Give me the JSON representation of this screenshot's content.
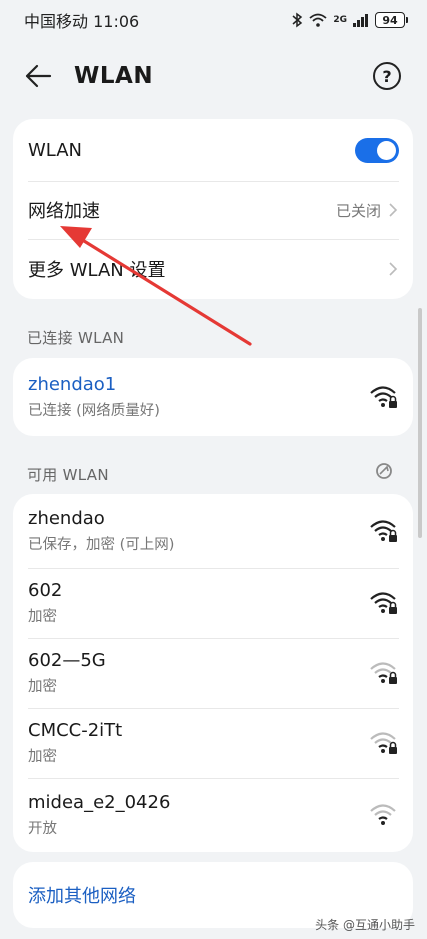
{
  "status_bar": {
    "carrier_time": "中国移动 11:06",
    "network": "2G",
    "battery": "94"
  },
  "header": {
    "title": "WLAN",
    "help": "?"
  },
  "settings": {
    "wlan_label": "WLAN",
    "wlan_enabled": true,
    "accel_label": "网络加速",
    "accel_value": "已关闭",
    "more_label": "更多 WLAN 设置"
  },
  "connected": {
    "section_title": "已连接 WLAN",
    "name": "zhendao1",
    "status": "已连接 (网络质量好)"
  },
  "available": {
    "section_title": "可用 WLAN",
    "networks": [
      {
        "name": "zhendao",
        "status": "已保存，加密 (可上网)"
      },
      {
        "name": "602",
        "status": "加密"
      },
      {
        "name": "602—5G",
        "status": "加密"
      },
      {
        "name": "CMCC-2iTt",
        "status": "加密"
      },
      {
        "name": "midea_e2_0426",
        "status": "开放"
      }
    ]
  },
  "add_network": "添加其他网络",
  "watermark": "头条 @互通小助手",
  "colors": {
    "accent": "#1a6fe8",
    "link": "#1b5fc2",
    "annotation_arrow": "#e53935"
  }
}
